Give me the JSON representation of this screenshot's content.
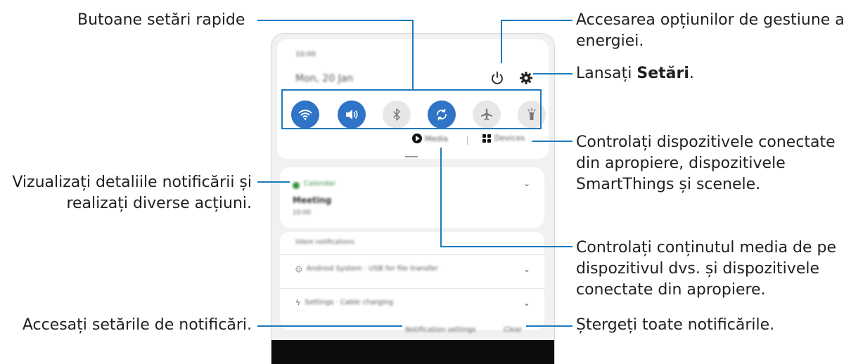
{
  "callouts": {
    "quick_settings": "Butoane setări rapide",
    "power_line1": "Accesarea opțiunilor de gestiune a",
    "power_line2": "energiei.",
    "settings_prefix": "Lansați ",
    "settings_bold": "Setări",
    "settings_suffix": ".",
    "devices_line1": "Controlați dispozitivele conectate",
    "devices_line2": "din apropiere, dispozitivele",
    "devices_line3": "SmartThings și scenele.",
    "notif_details_line1": "Vizualizați detaliile notificării și",
    "notif_details_line2": "realizați diverse acțiuni.",
    "media_line1": "Controlați conținutul media de pe",
    "media_line2": "dispozitivul dvs. și dispozitivele",
    "media_line3": "conectate din apropiere.",
    "notif_settings": "Accesați setările de notificări.",
    "clear_all": "Ștergeți toate notificările."
  },
  "phone": {
    "status_time": "10:00",
    "date": "Mon, 20 Jan",
    "media_label": "Media",
    "devices_label": "Devices",
    "quick_tiles": [
      {
        "name": "wifi",
        "state": "on"
      },
      {
        "name": "sound",
        "state": "on"
      },
      {
        "name": "bluetooth",
        "state": "off"
      },
      {
        "name": "auto-rotate",
        "state": "on"
      },
      {
        "name": "airplane-mode",
        "state": "off"
      },
      {
        "name": "flashlight",
        "state": "off"
      }
    ],
    "calendar_app": "Calendar",
    "meeting_title": "Meeting",
    "meeting_time": "10:00",
    "silent_header": "Silent notifications",
    "notif1": "Android System · USB for file transfer",
    "notif2": "Settings · Cable charging",
    "notification_settings": "Notification settings",
    "clear": "Clear"
  },
  "colors": {
    "accent": "#1e7bbf",
    "tile_on": "#2f74c6",
    "tile_off": "#e7e7e7"
  }
}
